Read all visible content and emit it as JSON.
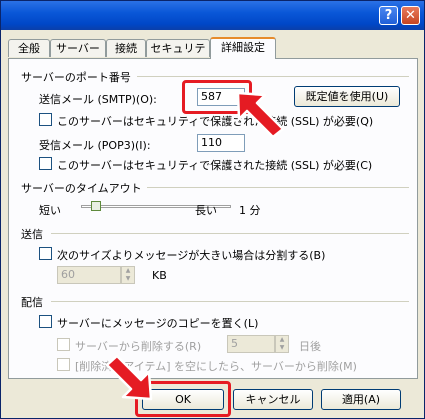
{
  "tabs": [
    {
      "label": "全般"
    },
    {
      "label": "サーバー"
    },
    {
      "label": "接続"
    },
    {
      "label": "セキュリティ"
    },
    {
      "label": "詳細設定"
    }
  ],
  "ports": {
    "group_title": "サーバーのポート番号",
    "smtp_label": "送信メール (SMTP)(O):",
    "smtp_value": "587",
    "default_button": "既定値を使用(U)",
    "smtp_ssl_label": "このサーバーはセキュリティで保護された接続 (SSL) が必要(Q)",
    "pop3_label": "受信メール (POP3)(I):",
    "pop3_value": "110",
    "pop3_ssl_label": "このサーバーはセキュリティで保護された接続 (SSL) が必要(C)"
  },
  "timeout": {
    "group_title": "サーバーのタイムアウト",
    "short": "短い",
    "long": "長い",
    "value": "1 分",
    "level": 0.1
  },
  "send": {
    "group_title": "送信",
    "split_label": "次のサイズよりメッセージが大きい場合は分割する(B)",
    "size_value": "60",
    "unit": "KB"
  },
  "delivery": {
    "group_title": "配信",
    "leave_copy_label": "サーバーにメッセージのコピーを置く(L)",
    "remove_after_label": "サーバーから削除する(R)",
    "days_value": "5",
    "days_unit": "日後",
    "remove_deleted_label": "[削除済みアイテム] を空にしたら、サーバーから削除(M)"
  },
  "buttons": {
    "ok": "OK",
    "cancel": "キャンセル",
    "apply": "適用(A)"
  },
  "colors": {
    "highlight": "#e51b23",
    "title_bar": "#0a57d8"
  }
}
